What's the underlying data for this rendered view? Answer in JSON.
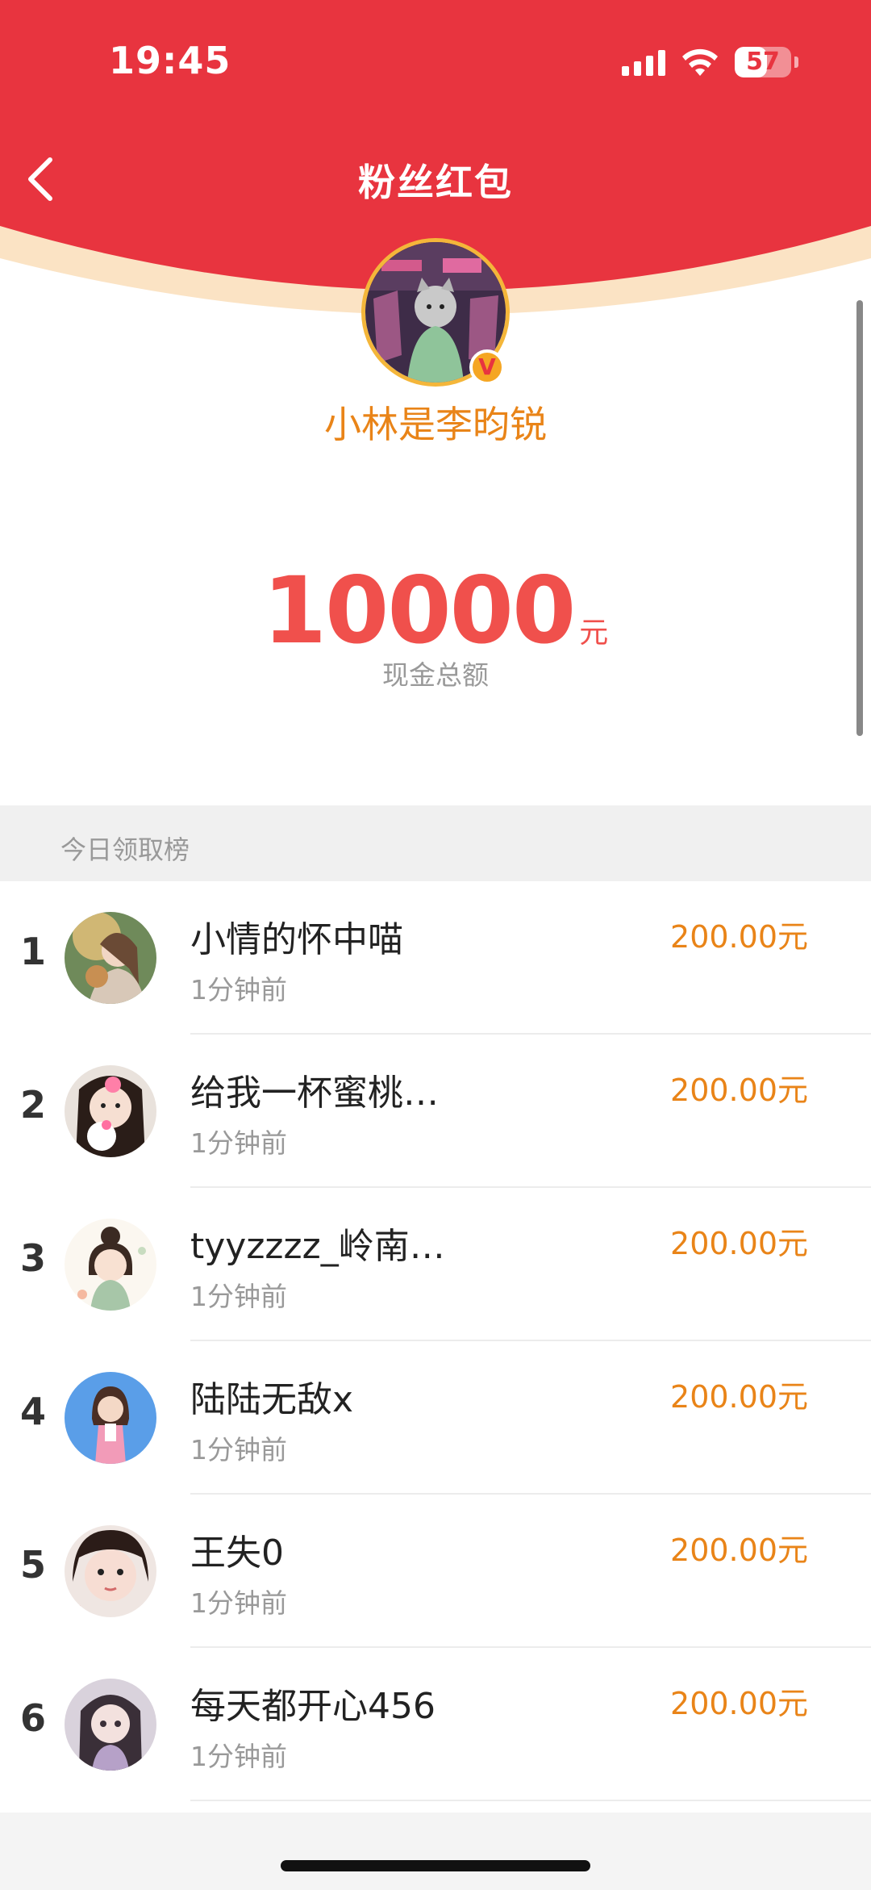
{
  "status_bar": {
    "time": "19:45",
    "battery": "57",
    "battery_level": 0.57
  },
  "nav": {
    "title": "粉丝红包"
  },
  "creator": {
    "name": "小林是李昀锐",
    "verified_badge": "V"
  },
  "amount": {
    "value": "10000",
    "unit": "元",
    "caption": "现金总额"
  },
  "board": {
    "title": "今日领取榜",
    "rows": [
      {
        "rank": "1",
        "name": "小情的怀中喵",
        "time": "1分钟前",
        "amount": "200.00元"
      },
      {
        "rank": "2",
        "name": "给我一杯蜜桃…",
        "time": "1分钟前",
        "amount": "200.00元"
      },
      {
        "rank": "3",
        "name": "tyyzzzz_岭南…",
        "time": "1分钟前",
        "amount": "200.00元"
      },
      {
        "rank": "4",
        "name": "陆陆无敌x",
        "time": "1分钟前",
        "amount": "200.00元"
      },
      {
        "rank": "5",
        "name": "王失0",
        "time": "1分钟前",
        "amount": "200.00元"
      },
      {
        "rank": "6",
        "name": "每天都开心456",
        "time": "1分钟前",
        "amount": "200.00元"
      }
    ]
  },
  "colors": {
    "header_red": "#e8343f",
    "accent_orange": "#e98418",
    "amount_red": "#f0504c",
    "header_glow": "#fbe3c4"
  }
}
